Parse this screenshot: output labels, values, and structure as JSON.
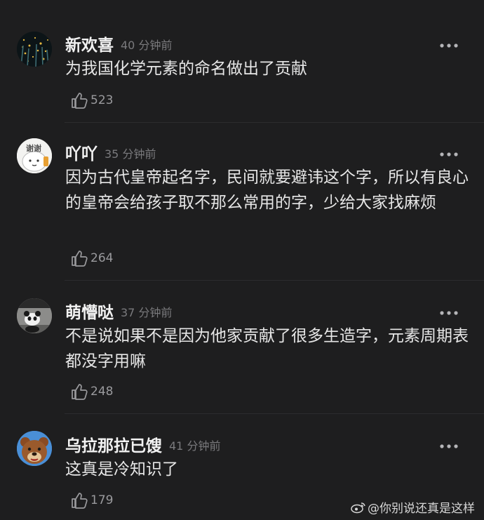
{
  "comments": [
    {
      "name": "新欢喜",
      "time": "40 分钟前",
      "text": "为我国化学元素的命名做出了贡献",
      "likes": "523",
      "avatar_icon": "starry-night-avatar-icon"
    },
    {
      "name": "吖吖",
      "time": "35 分钟前",
      "text": "因为古代皇帝起名字，民间就要避讳这个字，所以有良心的皇帝会给孩子取不那么常用的字，少给大家找麻烦",
      "likes": "264",
      "avatar_icon": "xiexie-cartoon-avatar-icon",
      "avatar_text": "谢谢"
    },
    {
      "name": "萌懵哒",
      "time": "37 分钟前",
      "text": "不是说如果不是因为他家贡献了很多生造字，元素周期表都没字用嘛",
      "likes": "248",
      "avatar_icon": "panda-avatar-icon"
    },
    {
      "name": "乌拉那拉已馊",
      "time": "41 分钟前",
      "text": "这真是冷知识了",
      "likes": "179",
      "avatar_icon": "bear-avatar-icon"
    }
  ],
  "watermark": {
    "text": "@你别说还真是这样",
    "icon": "weibo-logo-icon"
  },
  "colors": {
    "background": "#1e1e1f",
    "name": "#f2f2f2",
    "time": "#7a7a7d",
    "text": "#e6e6e6",
    "meta": "#9a9a9d"
  }
}
